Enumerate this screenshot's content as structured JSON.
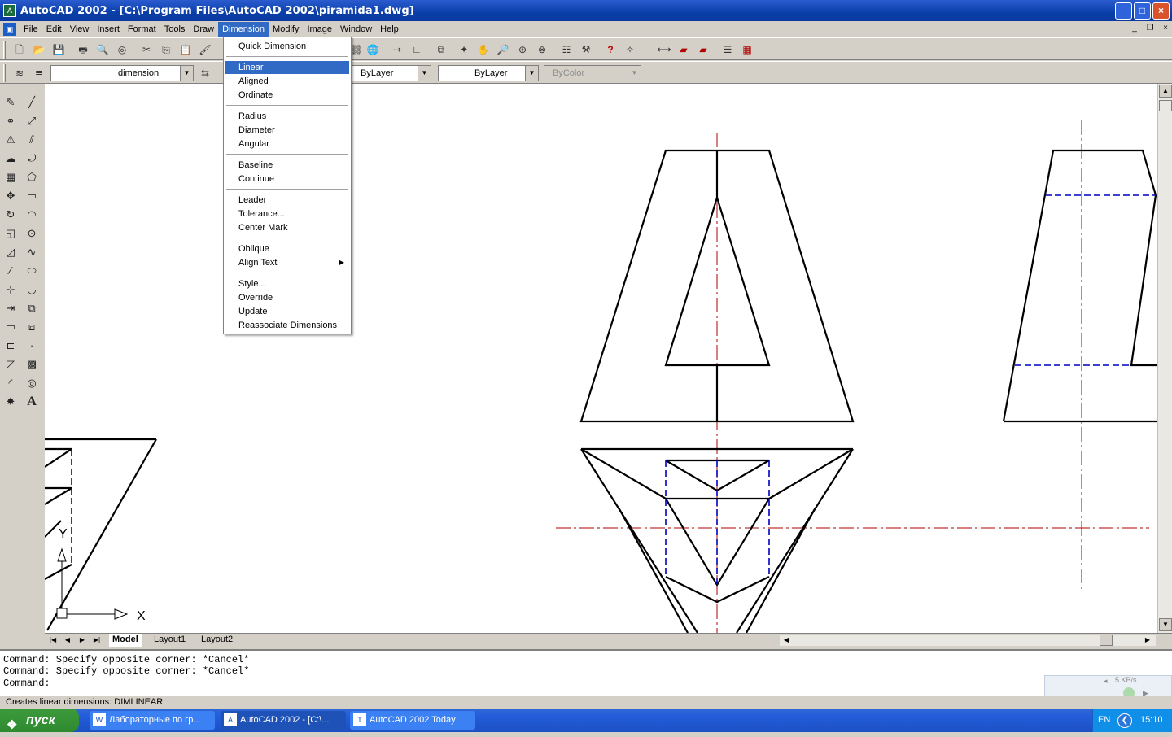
{
  "window": {
    "title": "AutoCAD 2002 - [C:\\Program Files\\AutoCAD 2002\\piramida1.dwg]",
    "buttons": [
      "_",
      "□",
      "×"
    ]
  },
  "menubar": {
    "items": [
      "File",
      "Edit",
      "View",
      "Insert",
      "Format",
      "Tools",
      "Draw",
      "Dimension",
      "Modify",
      "Image",
      "Window",
      "Help"
    ],
    "active": "Dimension"
  },
  "properties": {
    "layer": "dimension",
    "linetype": "ByLayer",
    "lineweight": "ByLayer",
    "color": "ByColor"
  },
  "dimension_menu": {
    "items": [
      {
        "label": "Quick Dimension"
      },
      {
        "label": "Linear",
        "selected": true
      },
      {
        "label": "Aligned"
      },
      {
        "label": "Ordinate"
      },
      {
        "label": "Radius"
      },
      {
        "label": "Diameter"
      },
      {
        "label": "Angular"
      },
      {
        "label": "Baseline"
      },
      {
        "label": "Continue"
      },
      {
        "label": "Leader"
      },
      {
        "label": "Tolerance..."
      },
      {
        "label": "Center Mark"
      },
      {
        "label": "Oblique"
      },
      {
        "label": "Align Text"
      },
      {
        "label": "Style..."
      },
      {
        "label": "Override"
      },
      {
        "label": "Update"
      },
      {
        "label": "Reassociate Dimensions"
      }
    ]
  },
  "ucs": {
    "x_label": "X",
    "y_label": "Y"
  },
  "tabs": {
    "items": [
      "Model",
      "Layout1",
      "Layout2"
    ],
    "active": "Model"
  },
  "command_history": [
    "Command: Specify opposite corner: *Cancel*",
    "Command: Specify opposite corner: *Cancel*",
    "Command:"
  ],
  "status_text": "Creates linear dimensions:  DIMLINEAR",
  "net_widget": {
    "speed": "5 KB/s"
  },
  "taskbar": {
    "start_label": "пуск",
    "tasks": [
      "Лабораторные по гр...",
      "AutoCAD 2002 - [C:\\...",
      "AutoCAD 2002 Today"
    ],
    "lang": "EN",
    "clock": "15:10"
  },
  "colors": {
    "titlebar": "#0a3ea8",
    "menu_highlight": "#316ac5",
    "canvas": "#ffffff",
    "centerline": "#b00000",
    "hidden_line": "#0000c0"
  }
}
